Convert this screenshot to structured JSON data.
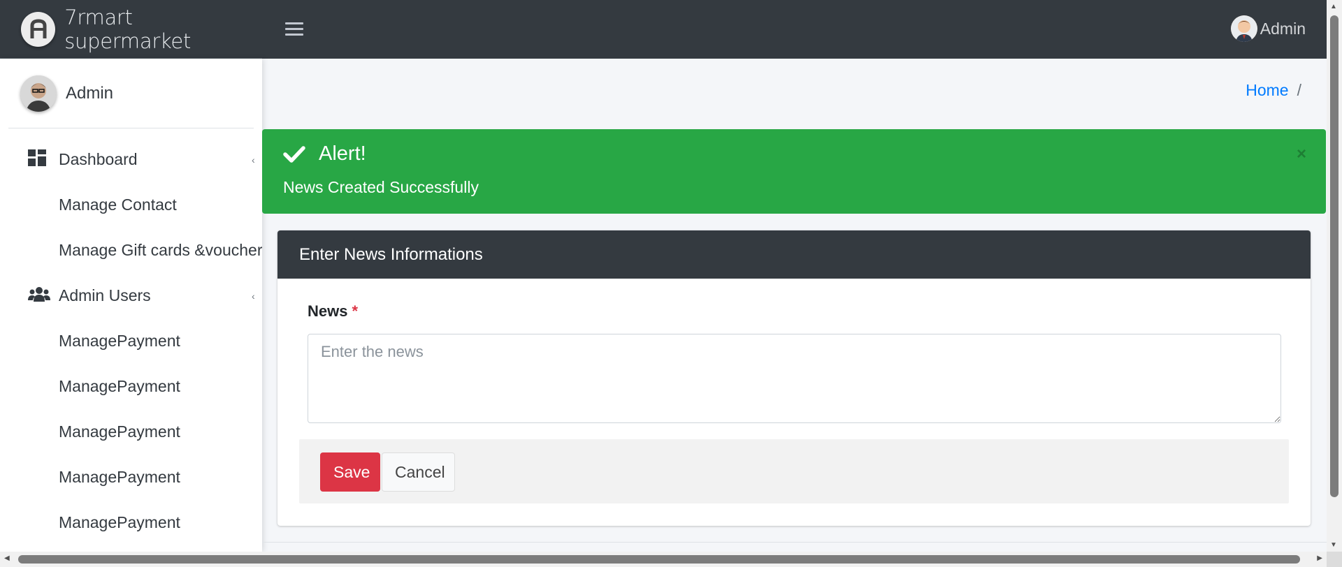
{
  "app": {
    "brand_name": "7rmart supermarket",
    "header_user": "Admin"
  },
  "sidebar": {
    "user_name": "Admin",
    "items": [
      {
        "label": "Dashboard",
        "icon": "dashboard-icon",
        "has_caret": true
      },
      {
        "label": "Manage Contact",
        "icon": "",
        "has_caret": false
      },
      {
        "label": "Manage Gift cards &voucher",
        "icon": "",
        "has_caret": false
      },
      {
        "label": "Admin Users",
        "icon": "users-icon",
        "has_caret": true
      },
      {
        "label": "ManagePayment",
        "icon": "",
        "has_caret": false
      },
      {
        "label": "ManagePayment",
        "icon": "",
        "has_caret": false
      },
      {
        "label": "ManagePayment",
        "icon": "",
        "has_caret": false
      },
      {
        "label": "ManagePayment",
        "icon": "",
        "has_caret": false
      },
      {
        "label": "ManagePayment",
        "icon": "",
        "has_caret": false
      }
    ]
  },
  "breadcrumb": {
    "home": "Home",
    "separator": "/"
  },
  "alert": {
    "title": "Alert!",
    "message": "News Created Successfully",
    "close": "×",
    "color": "#28a745"
  },
  "form": {
    "header": "Enter News Informations",
    "news_label": "News",
    "required_mark": "*",
    "news_placeholder": "Enter the news",
    "news_value": "",
    "save_label": "Save",
    "cancel_label": "Cancel"
  },
  "colors": {
    "navbar": "#343a40",
    "primary_link": "#007bff",
    "danger": "#dc3545",
    "success": "#28a745"
  }
}
